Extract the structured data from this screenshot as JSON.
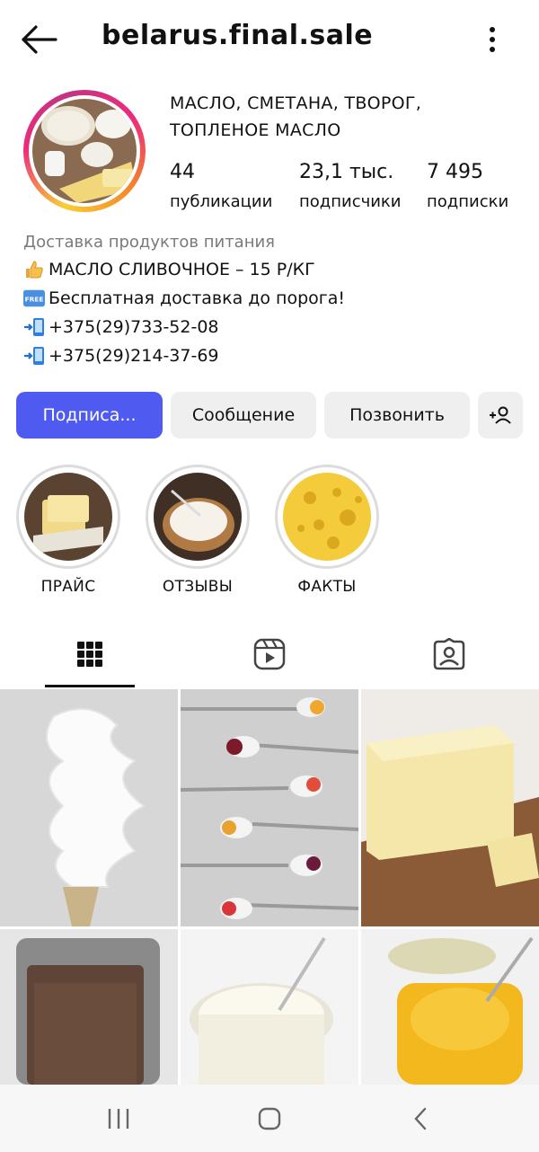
{
  "header": {
    "username": "belarus.final.sale",
    "back_icon": "back-arrow-icon",
    "menu_icon": "more-vertical-icon"
  },
  "profile": {
    "name_line1": "МАСЛО, СМЕТАНА, ТВОРОГ,",
    "name_line2": "ТОПЛЕНОЕ МАСЛО",
    "stats": [
      {
        "value": "44",
        "label": "публикации"
      },
      {
        "value": "23,1 тыс.",
        "label": "подписчики"
      },
      {
        "value": "7 495",
        "label": "подписки"
      }
    ]
  },
  "bio": {
    "category": "Доставка продуктов питания",
    "lines": [
      {
        "icon": "thumbs-up-icon",
        "text": "МАСЛО СЛИВОЧНОЕ – 15 Р/КГ"
      },
      {
        "icon": "free-badge-icon",
        "text": "Бесплатная доставка до порога!"
      },
      {
        "icon": "phone-arrow-icon",
        "text": "+375(29)733-52-08"
      },
      {
        "icon": "phone-arrow-icon",
        "text": "+375(29)214-37-69"
      }
    ],
    "free_badge": "FREE"
  },
  "actions": {
    "follow": "Подписа...",
    "message": "Сообщение",
    "call": "Позвонить",
    "add_user_icon": "add-user-icon"
  },
  "highlights": [
    {
      "label": "ПРАЙС"
    },
    {
      "label": "ОТЗЫВЫ"
    },
    {
      "label": "ФАКТЫ"
    }
  ],
  "tabs": [
    {
      "name": "grid-icon",
      "active": true
    },
    {
      "name": "reels-icon",
      "active": false
    },
    {
      "name": "tagged-icon",
      "active": false
    }
  ],
  "colors": {
    "primary": "#4f5bf0",
    "button_bg": "#efefef",
    "muted_text": "#7a7a7a"
  }
}
